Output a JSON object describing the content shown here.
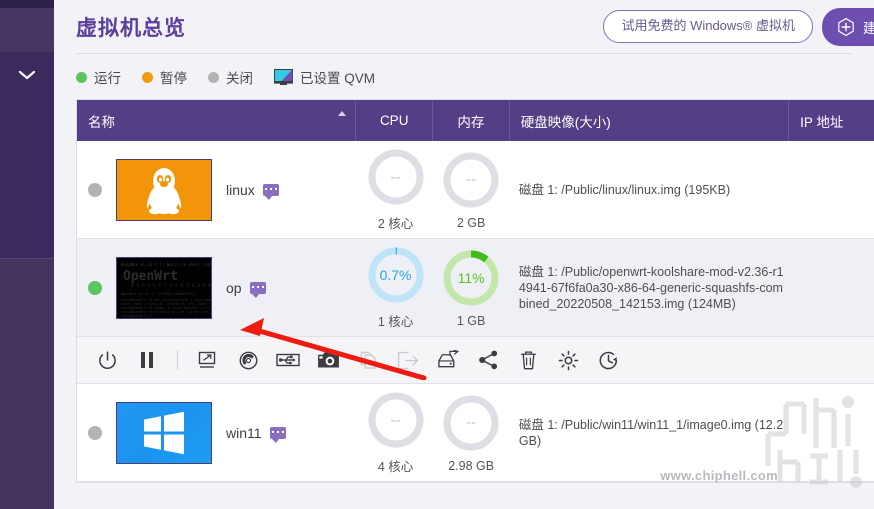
{
  "header": {
    "title": "虚拟机总览",
    "trial_button": "试用免费的 Windows® 虚拟机",
    "create_button": "建立"
  },
  "legend": {
    "items": [
      {
        "label": "运行",
        "color": "#5dc560",
        "icon": "status-dot-green"
      },
      {
        "label": "暂停",
        "color": "#ef9e12",
        "icon": "status-dot-orange"
      },
      {
        "label": "关闭",
        "color": "#b3b3b3",
        "icon": "status-dot-gray"
      },
      {
        "label": "已设置 QVM",
        "color": "#35c9e8",
        "icon": "monitor-icon"
      }
    ]
  },
  "table": {
    "columns": {
      "name": "名称",
      "cpu": "CPU",
      "memory": "内存",
      "disk": "硬盘映像(大小)",
      "ip": "IP 地址"
    },
    "rows": [
      {
        "status": "stopped",
        "thumb": "linux-tux",
        "name": "linux",
        "cpu_value": "--",
        "cpu_sub": "2 核心",
        "cpu_percent": 0,
        "mem_value": "--",
        "mem_sub": "2 GB",
        "mem_percent": 0,
        "disk": "磁盘 1: /Public/linux/linux.img (195KB)",
        "ip": ""
      },
      {
        "status": "running",
        "thumb": "openwrt-terminal",
        "name": "op",
        "cpu_value": "0.7%",
        "cpu_sub": "1 核心",
        "cpu_percent": 0.7,
        "mem_value": "11%",
        "mem_sub": "1 GB",
        "mem_percent": 11,
        "disk": "磁盘 1: /Public/openwrt-koolshare-mod-v2.36-r14941-67f6fa0a30-x86-64-generic-squashfs-combined_20220508_142153.img (124MB)",
        "ip": ""
      },
      {
        "status": "stopped",
        "thumb": "windows-logo",
        "name": "win11",
        "cpu_value": "--",
        "cpu_sub": "4 核心",
        "cpu_percent": 0,
        "mem_value": "--",
        "mem_sub": "2.98 GB",
        "mem_percent": 0,
        "disk": "磁盘 1: /Public/win11/win11_1/image0.img (12.2GB)",
        "ip": ""
      }
    ]
  },
  "action_bar": {
    "buttons": [
      {
        "name": "power-icon",
        "enabled": true
      },
      {
        "name": "pause-icon",
        "enabled": true
      },
      {
        "name": "console-icon",
        "enabled": true
      },
      {
        "name": "disc-icon",
        "enabled": true
      },
      {
        "name": "usb-icon",
        "enabled": true
      },
      {
        "name": "snapshot-camera-icon",
        "enabled": true
      },
      {
        "name": "clone-icon",
        "enabled": false
      },
      {
        "name": "export-icon",
        "enabled": false
      },
      {
        "name": "backup-icon",
        "enabled": true
      },
      {
        "name": "share-icon",
        "enabled": true
      },
      {
        "name": "delete-trash-icon",
        "enabled": true
      },
      {
        "name": "settings-gear-icon",
        "enabled": true
      },
      {
        "name": "history-clock-icon",
        "enabled": true
      }
    ]
  },
  "watermark": {
    "text": "www.chiphell.com",
    "logo": "chiphell-logo"
  },
  "colors": {
    "brand_purple": "#5b3f9d",
    "table_header": "#543f86",
    "sidebar": "#3b2b5c",
    "cpu_ring": "#29a7e8",
    "mem_ring": "#5dc21e",
    "annotation_arrow": "#ee1b11"
  }
}
